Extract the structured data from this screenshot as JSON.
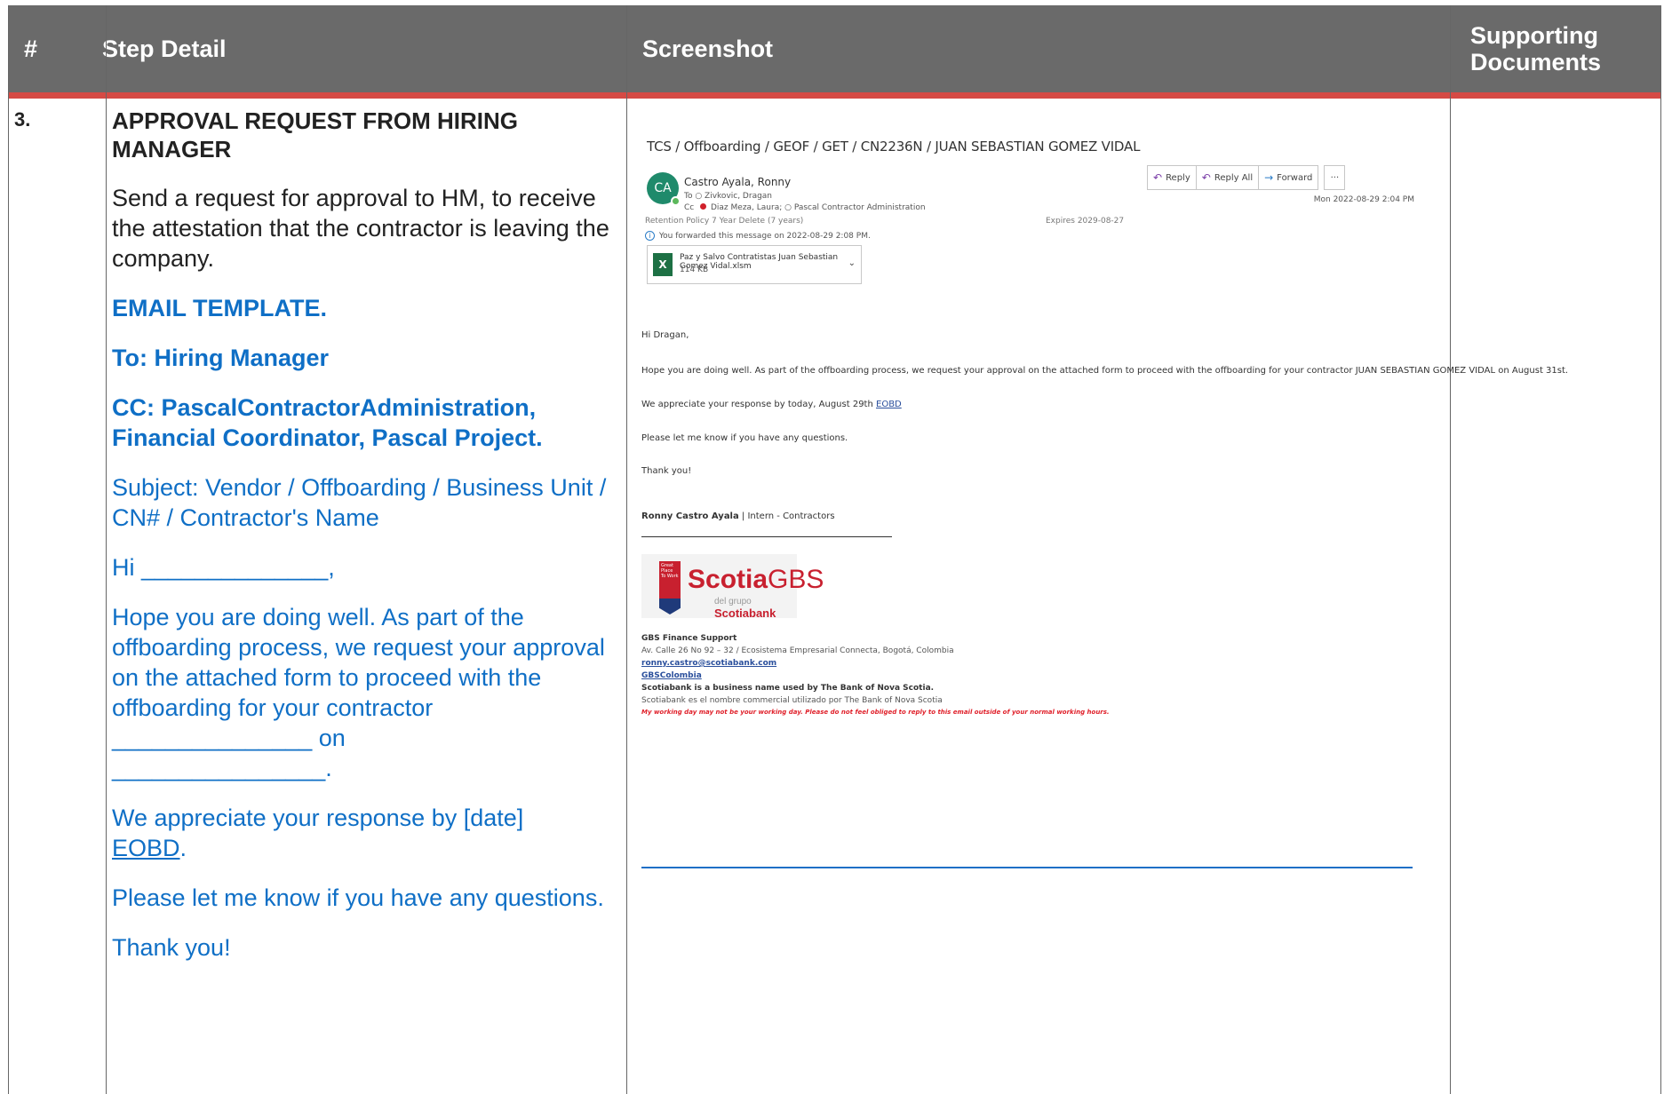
{
  "header": {
    "num": "#",
    "step_detail": "Step Detail",
    "screenshot": "Screenshot",
    "supporting_line1": "Supporting",
    "supporting_line2": "Documents"
  },
  "step": {
    "number": "3.",
    "title": "APPROVAL REQUEST FROM HIRING MANAGER",
    "description": "Send a request for approval to HM, to receive the attestation that the contractor is leaving the company.",
    "template_label": "EMAIL TEMPLATE.",
    "to_line": "To: Hiring Manager",
    "cc_line": "CC: PascalContractorAdministration, Financial Coordinator, Pascal Project.",
    "subject_line": "Subject: Vendor / Offboarding / Business Unit / CN# / Contractor's Name",
    "greeting": "Hi ______________,",
    "body_intro": "Hope you are doing well. As part of the offboarding process, we request your approval on the attached form to proceed with the offboarding for your contractor",
    "blank_contractor": "_______________",
    "on_word": "on",
    "blank_date": "________________.",
    "appreciate": "We appreciate your response by [date]",
    "eobd": "EOBD",
    "eobd_tail": ".",
    "questions": "Please let me know if you have any questions.",
    "thanks": "Thank you!"
  },
  "email": {
    "subject": "TCS / Offboarding / GEOF / GET  / CN2236N / JUAN SEBASTIAN GOMEZ VIDAL",
    "avatar_initials": "CA",
    "sender": "Castro Ayala, Ronny",
    "to": "To  ○ Zivkovic, Dragan",
    "cc_label": "Cc",
    "cc_names": "Diaz Meza, Laura;  ○ Pascal Contractor Administration",
    "retention": "Retention Policy  7 Year Delete (7 years)",
    "expires": "Expires  2029-08-27",
    "forwarded": "You forwarded this message on 2022-08-29 2:08 PM.",
    "attachment_name": "Paz y Salvo Contratistas Juan Sebastian Gomez Vidal.xlsm",
    "attachment_size": "114 KB",
    "reply": "Reply",
    "reply_all": "Reply All",
    "forward": "Forward",
    "more": "···",
    "date": "Mon 2022-08-29 2:04 PM",
    "greeting": "Hi Dragan,",
    "body": "Hope you are doing well. As part of the offboarding process, we request your approval on the attached form to proceed with the offboarding for your contractor JUAN SEBASTIAN GOMEZ VIDAL on August 31st.",
    "appreciate": "We appreciate your response by today, August 29th",
    "eobd": "EOBD",
    "questions": "Please let me know if you have any questions.",
    "thanks": "Thank you!",
    "signature_name": "Ronny Castro Ayala",
    "signature_role": " | Intern - Contractors",
    "logo_flag": "Great Place To Work",
    "logo_scotia": "Scotia",
    "logo_gbs": "GBS",
    "logo_sub": "del grupo",
    "logo_sub_brand": "Scotiabank",
    "sig_dept": "GBS Finance Support",
    "sig_address": "Av. Calle 26 No 92 – 32 / Ecosistema Empresarial Connecta, Bogotá, Colombia",
    "sig_email": "ronny.castro@scotiabank.com",
    "sig_link": "GBSColombia",
    "sig_legal_en": "Scotiabank is a business name used by The Bank of Nova Scotia.",
    "sig_legal_es": "Scotiabank es el nombre commercial utilizado por The Bank of Nova Scotia",
    "sig_disclaimer": "My working day may not be your working day. Please do not feel obliged to reply to this email outside of your normal working hours."
  },
  "colors": {
    "header_bg": "#6a6a6a",
    "header_accent": "#d54a45",
    "template_blue": "#0f6fc6"
  }
}
